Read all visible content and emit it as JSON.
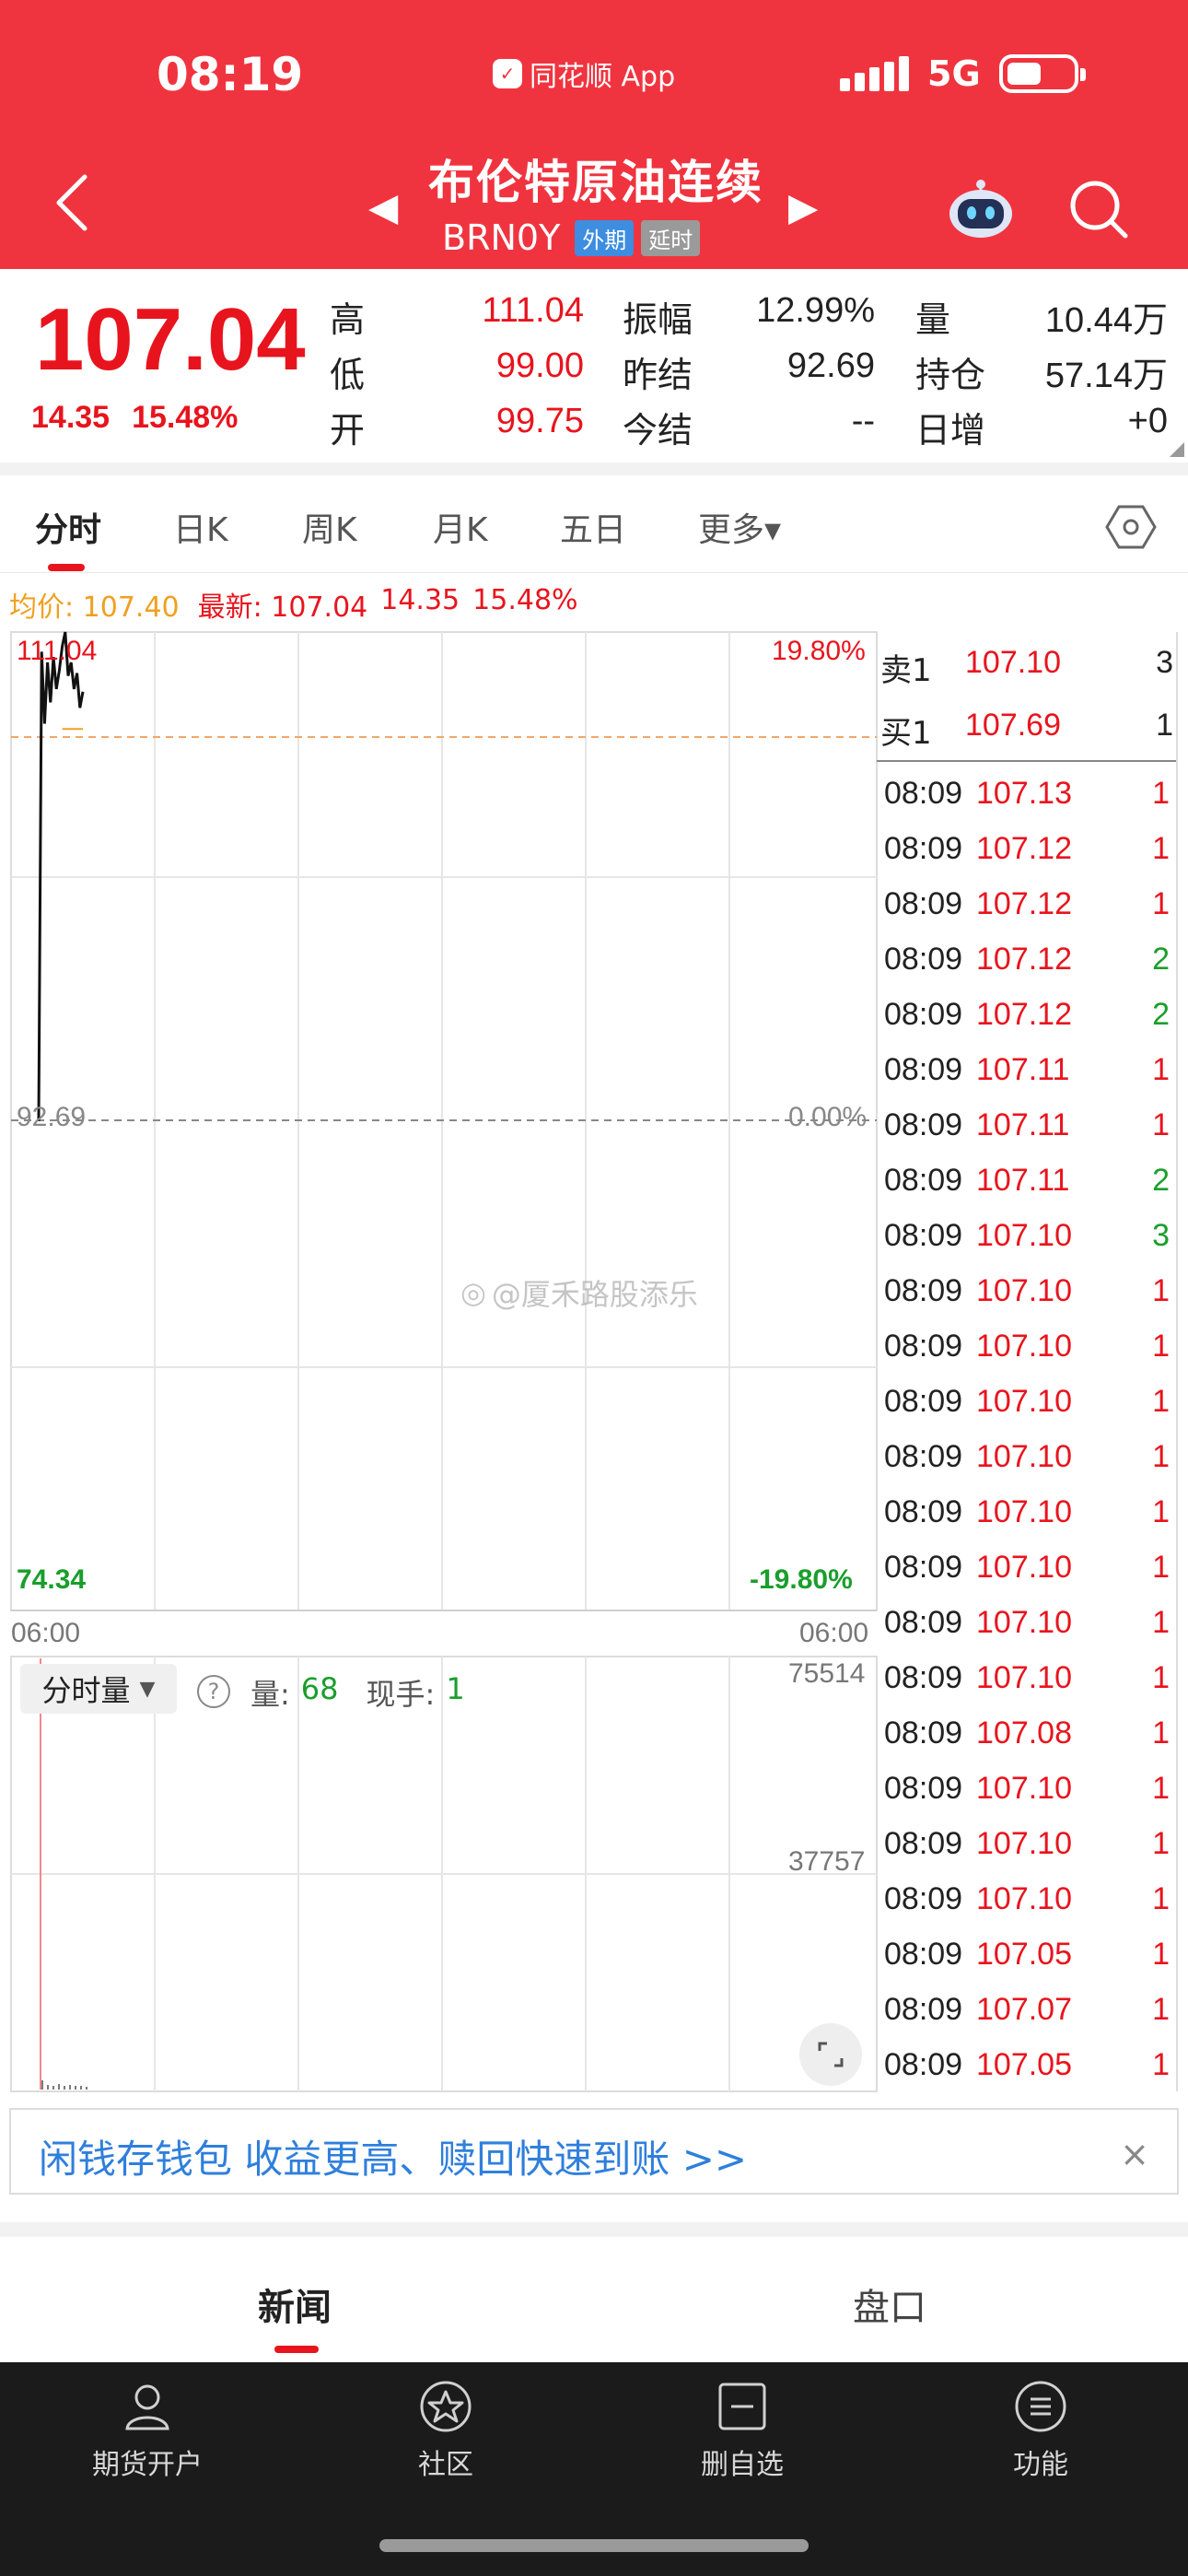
{
  "status": {
    "time": "08:19",
    "app": "同花顺 App",
    "network": "5G"
  },
  "header": {
    "title": "布伦特原油连续",
    "code": "BRN0Y",
    "tag_foreign": "外期",
    "tag_delay": "延时"
  },
  "quote": {
    "price": "107.04",
    "change": "14.35",
    "change_pct": "15.48%",
    "cells": [
      {
        "label": "高",
        "value": "111.04"
      },
      {
        "label": "低",
        "value": "99.00"
      },
      {
        "label": "开",
        "value": "99.75"
      },
      {
        "label": "振幅",
        "value": "12.99%"
      },
      {
        "label": "昨结",
        "value": "92.69"
      },
      {
        "label": "今结",
        "value": "--"
      },
      {
        "label": "量",
        "value": "10.44万"
      },
      {
        "label": "持仓",
        "value": "57.14万"
      },
      {
        "label": "日增",
        "value": "+0"
      }
    ]
  },
  "tabs": [
    {
      "label": "分时"
    },
    {
      "label": "日K"
    },
    {
      "label": "周K"
    },
    {
      "label": "月K"
    },
    {
      "label": "五日"
    },
    {
      "label": "更多▾"
    }
  ],
  "info": {
    "avg_label": "均价: 107.40",
    "latest_label": "最新: 107.04",
    "chg": "14.35",
    "pct": "15.48%"
  },
  "chart": {
    "price_high": "111.04",
    "price_base": "92.69",
    "price_low": "74.34",
    "pct_high": "19.80%",
    "pct_base": "0.00%",
    "pct_low": "-19.80%",
    "time_start": "06:00",
    "time_end": "06:00",
    "vol_max": "75514",
    "vol_mid": "37757"
  },
  "chart_data": {
    "type": "line",
    "ylim": [
      74.34,
      111.04
    ],
    "baseline": 92.69,
    "avg_price": 107.4,
    "series": [
      {
        "values": [
          92.69,
          110.3,
          107.6,
          109.9,
          108.4,
          110.1,
          108.9,
          109.6,
          110.5,
          111.04,
          109.4,
          109.9,
          108.9,
          109.5,
          108.2,
          108.8
        ]
      }
    ]
  },
  "watermark": "@厦禾路股添乐",
  "volume": {
    "dropdown_label": "分时量",
    "help": "?",
    "vol_label": "量:",
    "vol_value": "68",
    "hand_label": "现手:",
    "hand_value": "1"
  },
  "orderbook": {
    "sell": {
      "label": "卖1",
      "price": "107.10",
      "qty": "3"
    },
    "buy": {
      "label": "买1",
      "price": "107.69",
      "qty": "1"
    },
    "trades": [
      {
        "time": "08:09",
        "price": "107.13",
        "qty": "1"
      },
      {
        "time": "08:09",
        "price": "107.12",
        "qty": "1"
      },
      {
        "time": "08:09",
        "price": "107.12",
        "qty": "1"
      },
      {
        "time": "08:09",
        "price": "107.12",
        "qty": "2"
      },
      {
        "time": "08:09",
        "price": "107.12",
        "qty": "2"
      },
      {
        "time": "08:09",
        "price": "107.11",
        "qty": "1"
      },
      {
        "time": "08:09",
        "price": "107.11",
        "qty": "1"
      },
      {
        "time": "08:09",
        "price": "107.11",
        "qty": "2"
      },
      {
        "time": "08:09",
        "price": "107.10",
        "qty": "3"
      },
      {
        "time": "08:09",
        "price": "107.10",
        "qty": "1"
      },
      {
        "time": "08:09",
        "price": "107.10",
        "qty": "1"
      },
      {
        "time": "08:09",
        "price": "107.10",
        "qty": "1"
      },
      {
        "time": "08:09",
        "price": "107.10",
        "qty": "1"
      },
      {
        "time": "08:09",
        "price": "107.10",
        "qty": "1"
      },
      {
        "time": "08:09",
        "price": "107.10",
        "qty": "1"
      },
      {
        "time": "08:09",
        "price": "107.10",
        "qty": "1"
      },
      {
        "time": "08:09",
        "price": "107.10",
        "qty": "1"
      },
      {
        "time": "08:09",
        "price": "107.08",
        "qty": "1"
      },
      {
        "time": "08:09",
        "price": "107.10",
        "qty": "1"
      },
      {
        "time": "08:09",
        "price": "107.10",
        "qty": "1"
      },
      {
        "time": "08:09",
        "price": "107.10",
        "qty": "1"
      },
      {
        "time": "08:09",
        "price": "107.05",
        "qty": "1"
      },
      {
        "time": "08:09",
        "price": "107.07",
        "qty": "1"
      },
      {
        "time": "08:09",
        "price": "107.05",
        "qty": "1"
      }
    ]
  },
  "banner": {
    "text": "闲钱存钱包 收益更高、赎回快速到账 >>",
    "close": "×"
  },
  "bottom_tabs": [
    {
      "label": "新闻"
    },
    {
      "label": "盘口"
    }
  ],
  "bottom_nav": [
    {
      "label": "期货开户",
      "icon": "user-account-icon"
    },
    {
      "label": "社区",
      "icon": "community-star-icon"
    },
    {
      "label": "删自选",
      "icon": "remove-watchlist-icon"
    },
    {
      "label": "功能",
      "icon": "menu-list-icon"
    }
  ],
  "colors": {
    "header": "#f0343f",
    "up": "#e8141d",
    "down": "#1a9e2c",
    "avg": "#f0a020"
  }
}
